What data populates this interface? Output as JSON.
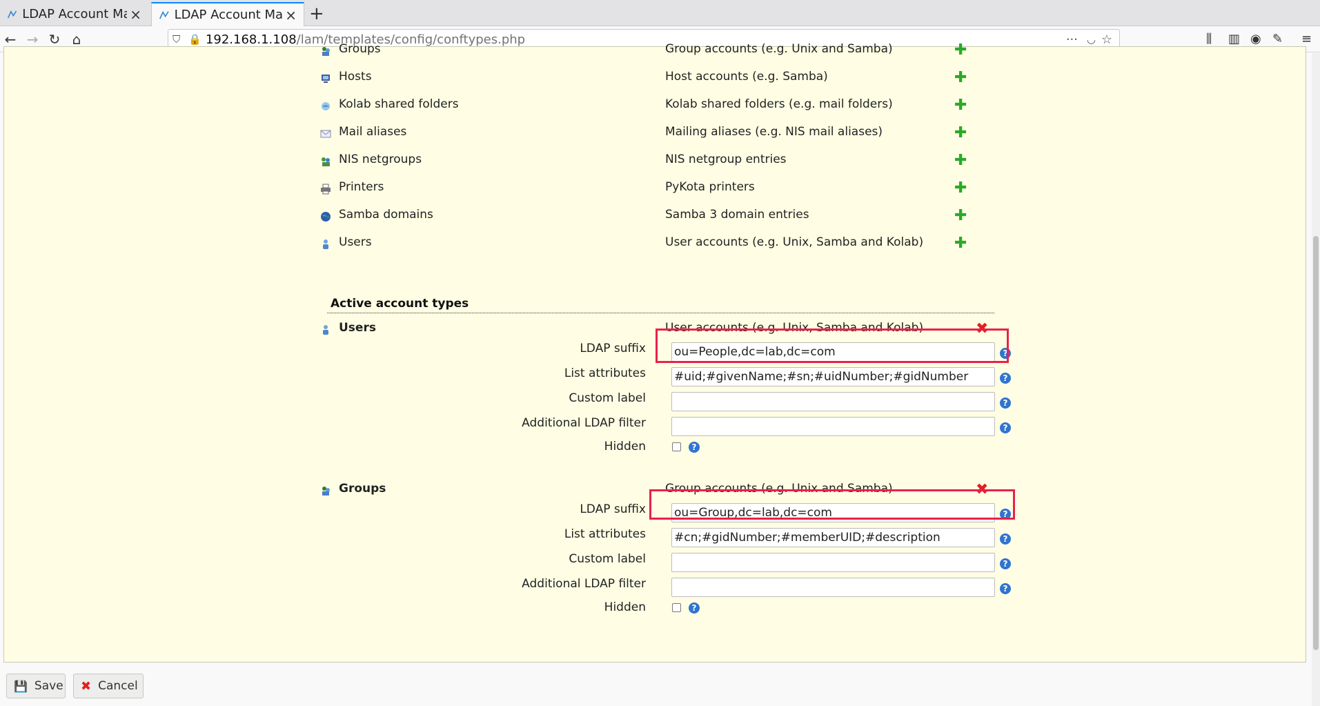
{
  "browser": {
    "tabs": [
      {
        "title": "LDAP Account Mana",
        "active": false
      },
      {
        "title": "LDAP Account Mana",
        "active": true
      }
    ],
    "url_host": "192.168.1.108",
    "url_path": "/lam/templates/config/conftypes.php",
    "accent": "#0a84ff"
  },
  "available_types": [
    {
      "name": "Groups",
      "description": "Group accounts (e.g. Unix and Samba)",
      "icon": "group-icon"
    },
    {
      "name": "Hosts",
      "description": "Host accounts (e.g. Samba)",
      "icon": "host-icon"
    },
    {
      "name": "Kolab shared folders",
      "description": "Kolab shared folders (e.g. mail folders)",
      "icon": "folder-icon"
    },
    {
      "name": "Mail aliases",
      "description": "Mailing aliases (e.g. NIS mail aliases)",
      "icon": "mail-icon"
    },
    {
      "name": "NIS netgroups",
      "description": "NIS netgroup entries",
      "icon": "netgroup-icon"
    },
    {
      "name": "Printers",
      "description": "PyKota printers",
      "icon": "printer-icon"
    },
    {
      "name": "Samba domains",
      "description": "Samba 3 domain entries",
      "icon": "globe-icon"
    },
    {
      "name": "Users",
      "description": "User accounts (e.g. Unix, Samba and Kolab)",
      "icon": "user-icon"
    }
  ],
  "active_section_title": "Active account types",
  "active_types": [
    {
      "name": "Users",
      "description": "User accounts (e.g. Unix, Samba and Kolab)",
      "fields": {
        "ldap_suffix_label": "LDAP suffix",
        "ldap_suffix_value": "ou=People,dc=lab,dc=com",
        "list_attributes_label": "List attributes",
        "list_attributes_value": "#uid;#givenName;#sn;#uidNumber;#gidNumber",
        "custom_label_label": "Custom label",
        "custom_label_value": "",
        "filter_label": "Additional LDAP filter",
        "filter_value": "",
        "hidden_label": "Hidden"
      }
    },
    {
      "name": "Groups",
      "description": "Group accounts (e.g. Unix and Samba)",
      "fields": {
        "ldap_suffix_label": "LDAP suffix",
        "ldap_suffix_value": "ou=Group,dc=lab,dc=com",
        "list_attributes_label": "List attributes",
        "list_attributes_value": "#cn;#gidNumber;#memberUID;#description",
        "custom_label_label": "Custom label",
        "custom_label_value": "",
        "filter_label": "Additional LDAP filter",
        "filter_value": "",
        "hidden_label": "Hidden"
      }
    }
  ],
  "buttons": {
    "save": "Save",
    "cancel": "Cancel"
  },
  "highlight_color": "#e8214a"
}
